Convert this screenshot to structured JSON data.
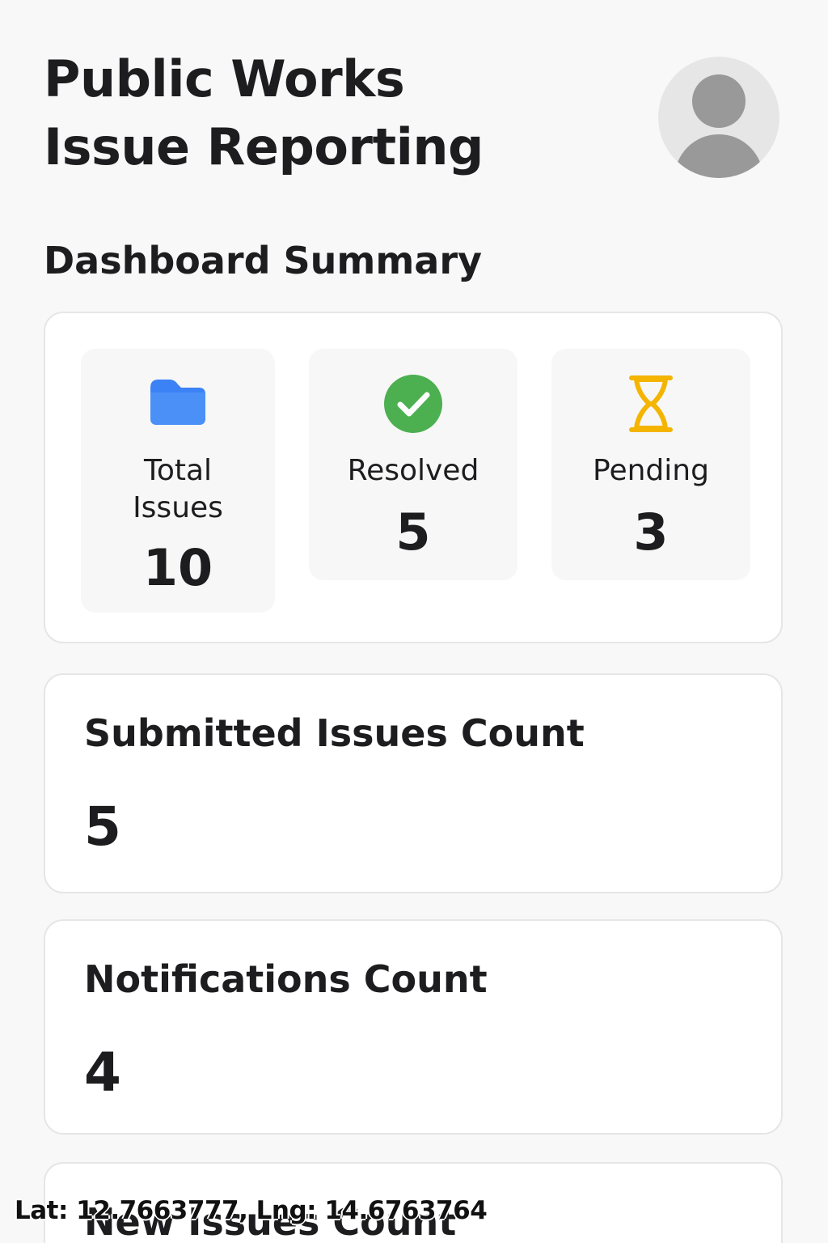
{
  "header": {
    "title": "Public Works Issue Reporting",
    "avatar_icon": "user-avatar-icon"
  },
  "dashboard": {
    "section_title": "Dashboard Summary",
    "stats": [
      {
        "label": "Total Issues",
        "value": "10",
        "icon": "folder-icon",
        "color": "#3B82F6"
      },
      {
        "label": "Resolved",
        "value": "5",
        "icon": "check-circle-icon",
        "color": "#4CAF50"
      },
      {
        "label": "Pending",
        "value": "3",
        "icon": "hourglass-icon",
        "color": "#F4B400"
      }
    ]
  },
  "counts": [
    {
      "label": "Submitted Issues Count",
      "value": "5"
    },
    {
      "label": "Notifications Count",
      "value": "4"
    },
    {
      "label": "New Issues Count",
      "value": ""
    }
  ],
  "overlay": {
    "coordinates": "Lat: 12.7663777, Lng: 14.6763764"
  }
}
